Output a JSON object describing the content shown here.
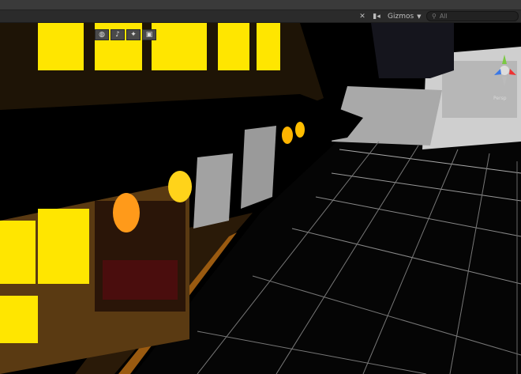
{
  "toolbar": {
    "gizmos_label": "Gizmos",
    "search_placeholder": "All",
    "tools_icon": "tools-icon",
    "camera_icon": "camera-icon"
  },
  "scene_view": {
    "projection_label": "Persp",
    "scene_tools": [
      "globe-icon",
      "audio-icon",
      "effects-icon",
      "layers-icon"
    ]
  },
  "colors": {
    "window_glow": "#ffe600",
    "lantern": "#ff9a1a",
    "toolbar_bg": "#2b2b2b"
  }
}
